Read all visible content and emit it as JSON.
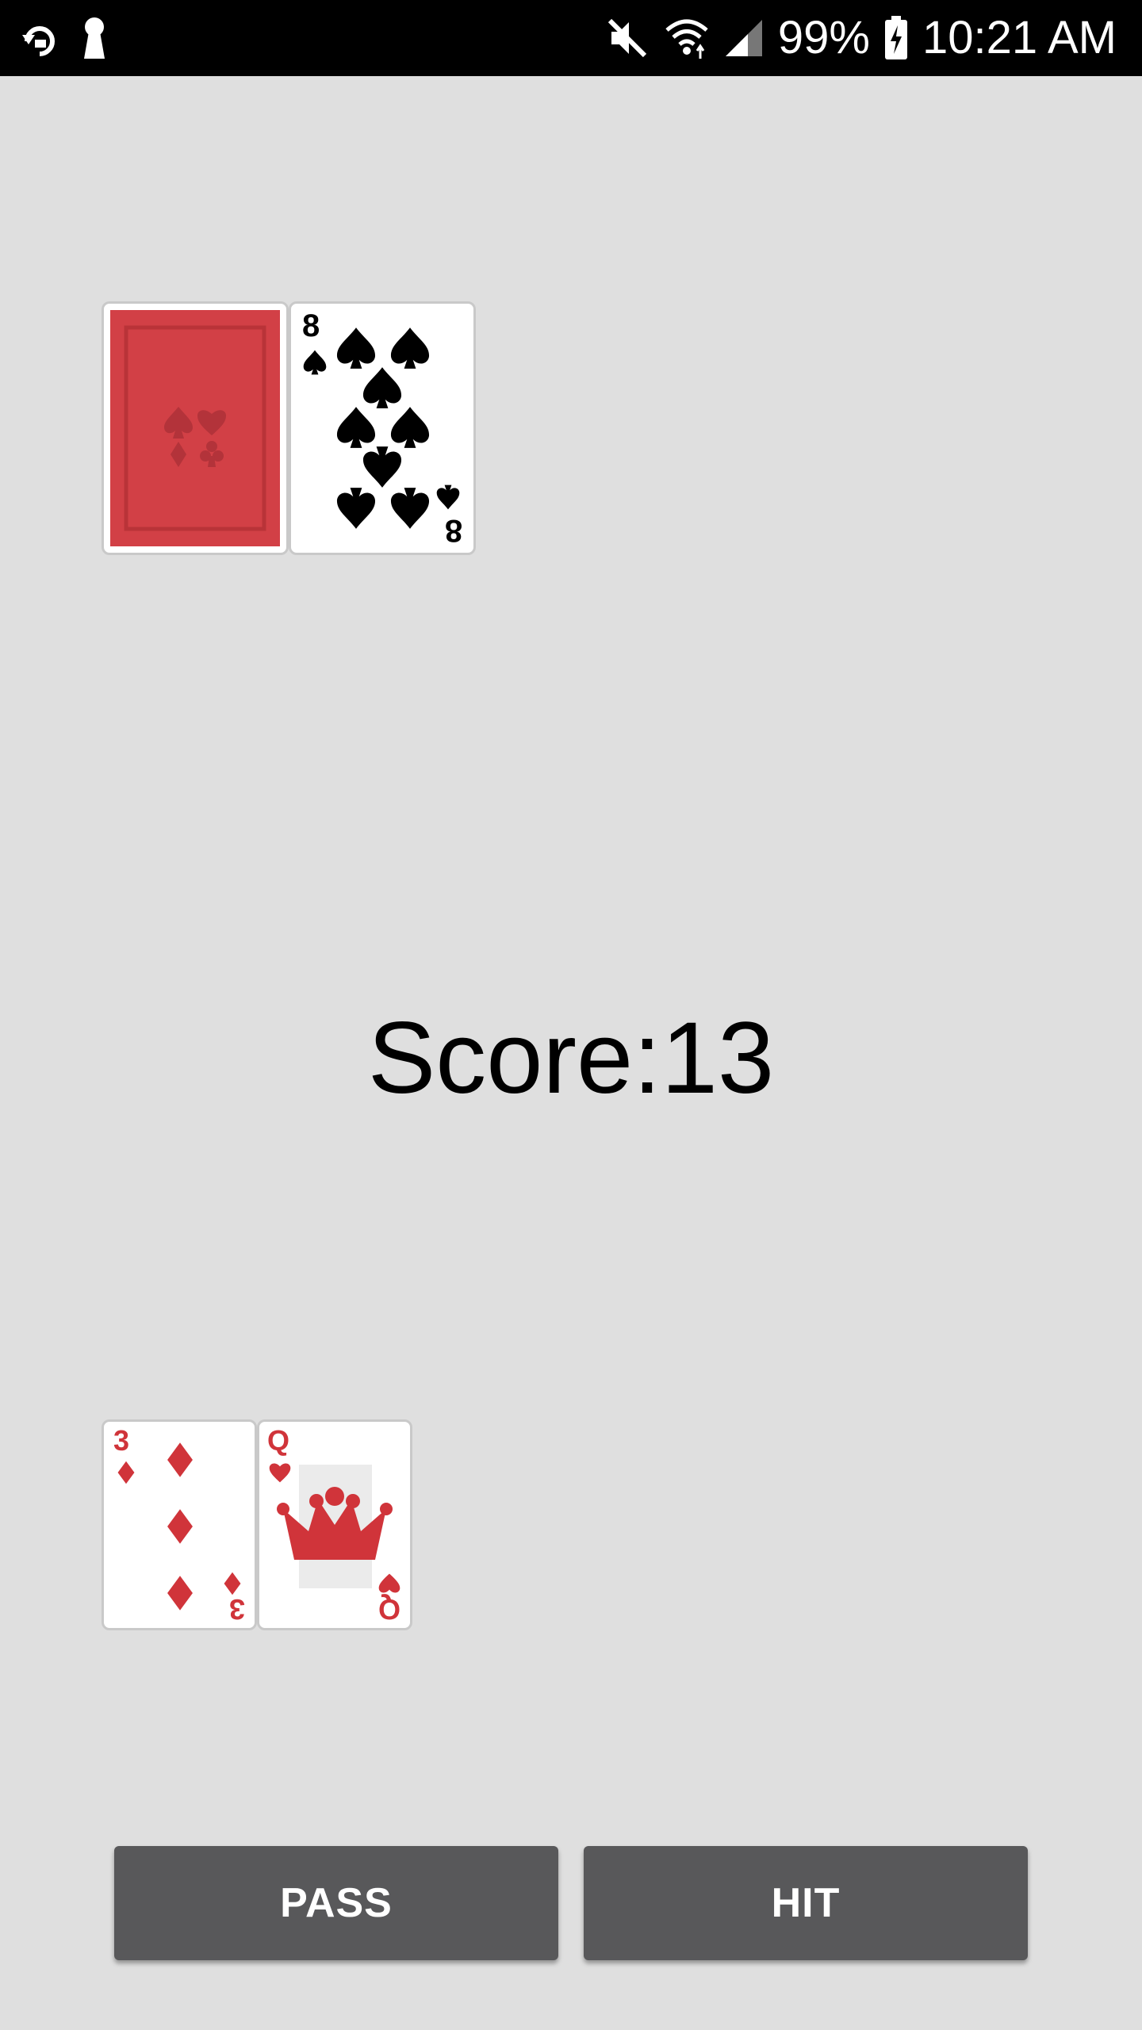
{
  "status_bar": {
    "battery": "99%",
    "time": "10:21 AM",
    "icons": [
      "sync-icon",
      "keyhole-icon",
      "mute-icon",
      "wifi-icon",
      "signal-icon",
      "battery-charging-icon"
    ]
  },
  "dealer_hand": {
    "cards": [
      {
        "face": "back",
        "color": "#d24046"
      },
      {
        "rank": "8",
        "suit": "spades",
        "color": "#000000"
      }
    ]
  },
  "score": {
    "label": "Score:13"
  },
  "player_hand": {
    "cards": [
      {
        "rank": "3",
        "suit": "diamonds",
        "color": "#d0343a"
      },
      {
        "rank": "Q",
        "suit": "hearts",
        "color": "#d0343a"
      }
    ]
  },
  "actions": {
    "pass_label": "PASS",
    "hit_label": "HIT"
  }
}
